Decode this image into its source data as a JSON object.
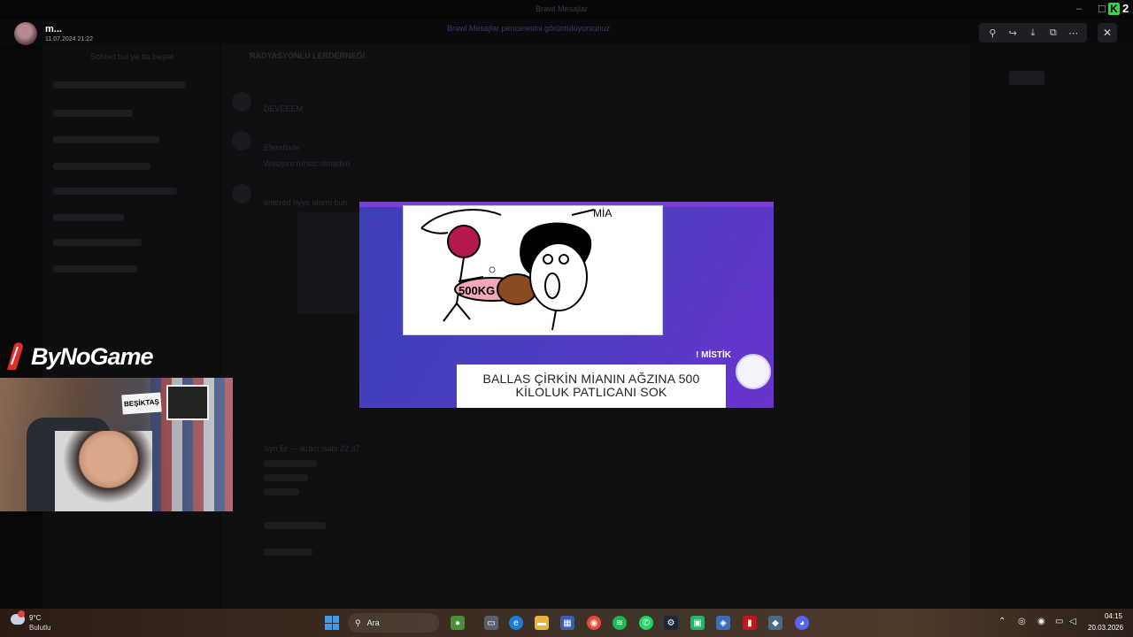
{
  "window": {
    "app_title": "Brawl Mesajlar",
    "minimize": "–",
    "maximize": "☐",
    "overlay_badge": "2"
  },
  "viewer": {
    "uploader": "m...",
    "upload_date": "11.07.2024 21:22",
    "tools": [
      {
        "name": "zoom-icon",
        "glyph": "⚲"
      },
      {
        "name": "forward-icon",
        "glyph": "↪"
      },
      {
        "name": "download-icon",
        "glyph": "⤓"
      },
      {
        "name": "open-external-icon",
        "glyph": "⧉"
      },
      {
        "name": "more-icon",
        "glyph": "⋯"
      }
    ],
    "close": "✕"
  },
  "image": {
    "name_tag": "! MİSTİK",
    "caption_line1": "BALLAS ÇİRKİN MİANIN AĞZINA 500",
    "caption_line2": "KİLOLUK PATLICANI SOK",
    "drawing_label_left": "500KG",
    "drawing_label_right": "MİA"
  },
  "background": {
    "channel_header": "RADYASYONLU LERDERNEĞİ",
    "sidebar_start": "Sohbet bul ya da başlat",
    "msg1": "DEVEEEM",
    "msg2": "Efendinde",
    "msg3": "Wasiyım ruhsiz olmadim",
    "msg4": "entered nyye alarm bun",
    "msg5": "Syn Er --- ikrâcı isabi 22:37",
    "banner": "Brawl Mesajlar penceresini görüntülüyorsunuz"
  },
  "branding": {
    "logo_text": "ByNoGame",
    "webcam_sign": "BEŞİKTAŞ"
  },
  "taskbar": {
    "weather_temp": "9°C",
    "weather_desc": "Bulutlu",
    "search_placeholder": "Ara",
    "time": "04:15",
    "date": "20.03.2026"
  }
}
